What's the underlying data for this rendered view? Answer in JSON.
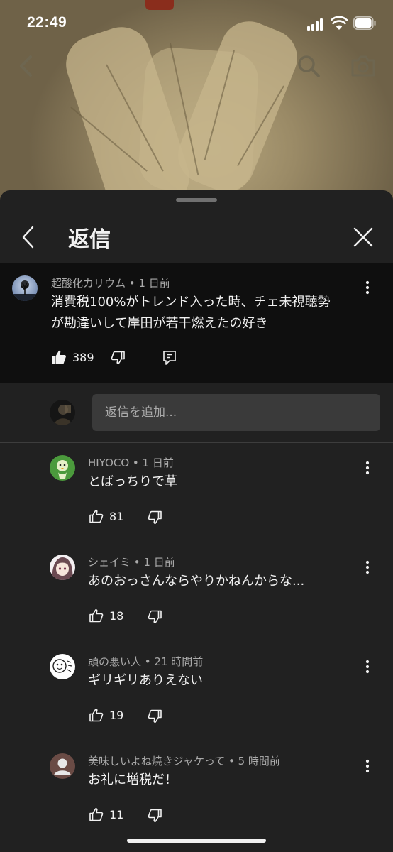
{
  "status_bar": {
    "time": "22:49"
  },
  "sheet": {
    "title": "返信"
  },
  "main_comment": {
    "author": "超酸化カリウム",
    "age": "1 日前",
    "text_lines": [
      "消費税100%がトレンド入った時、チェ未視聴勢",
      "が勘違いして岸田が若干燃えたの好き"
    ],
    "likes": "389"
  },
  "add_reply": {
    "placeholder": "返信を追加..."
  },
  "replies": [
    {
      "author": "HIYOCO",
      "age": "1 日前",
      "text": "とばっちりで草",
      "likes": "81"
    },
    {
      "author": "シェイミ",
      "age": "1 日前",
      "text": "あのおっさんならやりかねんからな...",
      "likes": "18"
    },
    {
      "author": "頭の悪い人",
      "age": "21 時間前",
      "text": "ギリギリありえない",
      "likes": "19"
    },
    {
      "author": "美味しいよね焼きジャケって",
      "age": "5 時間前",
      "text": "お礼に増税だ！",
      "likes": "11"
    }
  ],
  "separator": " • ",
  "colors": {
    "sheet_bg": "#212121",
    "main_comment_bg": "#0f0f0f",
    "text": "#f1f1f1",
    "meta": "#aaaaaa",
    "input_bg": "#3a3a3a"
  }
}
